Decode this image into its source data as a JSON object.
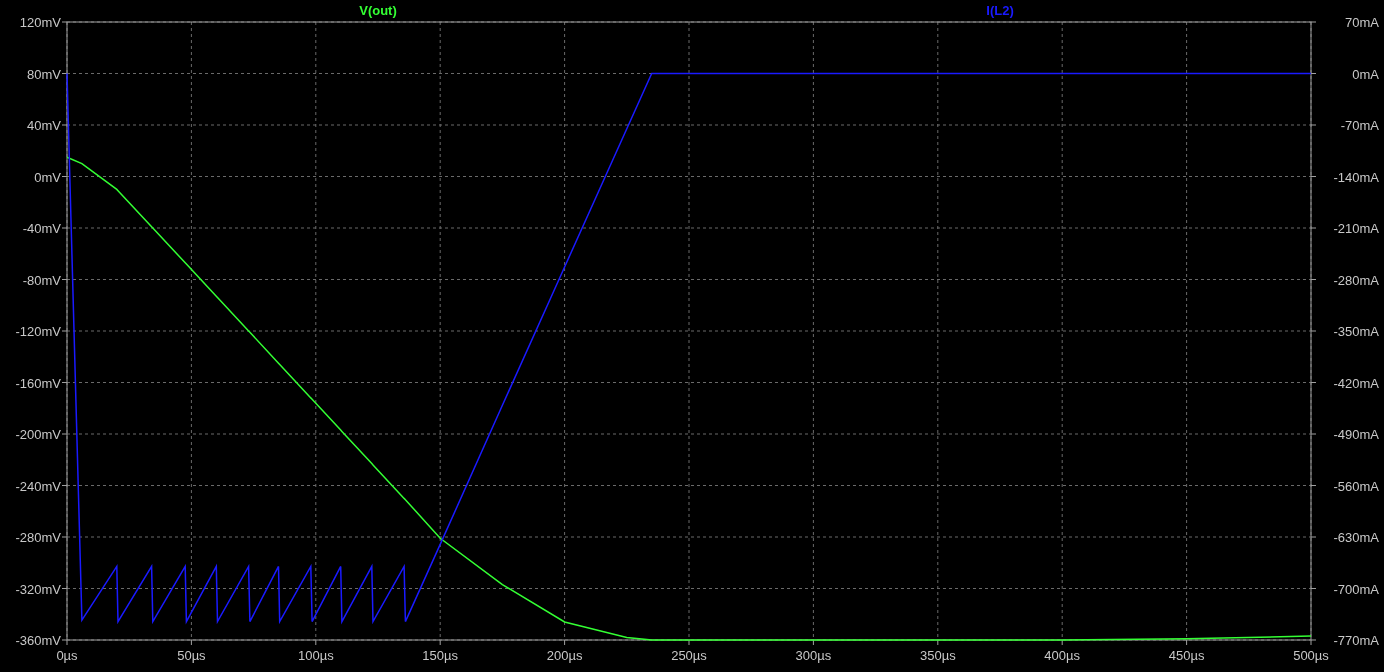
{
  "chart_data": {
    "type": "line",
    "grid": true,
    "xlim": [
      0,
      500
    ],
    "ylim": [
      -360,
      120
    ],
    "y2lim": [
      -770,
      70
    ],
    "xticks": [
      {
        "value": 0,
        "label": "0µs"
      },
      {
        "value": 50,
        "label": "50µs"
      },
      {
        "value": 100,
        "label": "100µs"
      },
      {
        "value": 150,
        "label": "150µs"
      },
      {
        "value": 200,
        "label": "200µs"
      },
      {
        "value": 250,
        "label": "250µs"
      },
      {
        "value": 300,
        "label": "300µs"
      },
      {
        "value": 350,
        "label": "350µs"
      },
      {
        "value": 400,
        "label": "400µs"
      },
      {
        "value": 450,
        "label": "450µs"
      },
      {
        "value": 500,
        "label": "500µs"
      }
    ],
    "yticks": [
      {
        "value": 120,
        "label": "120mV"
      },
      {
        "value": 80,
        "label": "80mV"
      },
      {
        "value": 40,
        "label": "40mV"
      },
      {
        "value": 0,
        "label": "0mV"
      },
      {
        "value": -40,
        "label": "-40mV"
      },
      {
        "value": -80,
        "label": "-80mV"
      },
      {
        "value": -120,
        "label": "-120mV"
      },
      {
        "value": -160,
        "label": "-160mV"
      },
      {
        "value": -200,
        "label": "-200mV"
      },
      {
        "value": -240,
        "label": "-240mV"
      },
      {
        "value": -280,
        "label": "-280mV"
      },
      {
        "value": -320,
        "label": "-320mV"
      },
      {
        "value": -360,
        "label": "-360mV"
      }
    ],
    "y2ticks": [
      {
        "value": 70,
        "label": "70mA"
      },
      {
        "value": 0,
        "label": "0mA"
      },
      {
        "value": -70,
        "label": "-70mA"
      },
      {
        "value": -140,
        "label": "-140mA"
      },
      {
        "value": -210,
        "label": "-210mA"
      },
      {
        "value": -280,
        "label": "-280mA"
      },
      {
        "value": -350,
        "label": "-350mA"
      },
      {
        "value": -420,
        "label": "-420mA"
      },
      {
        "value": -490,
        "label": "-490mA"
      },
      {
        "value": -560,
        "label": "-560mA"
      },
      {
        "value": -630,
        "label": "-630mA"
      },
      {
        "value": -700,
        "label": "-700mA"
      },
      {
        "value": -770,
        "label": "-770mA"
      }
    ],
    "x": [
      0,
      6,
      20,
      20.5,
      34,
      34.5,
      47.5,
      48,
      60,
      60.5,
      73,
      73.5,
      85,
      85.5,
      98,
      98.5,
      110,
      110.5,
      122.5,
      123,
      135.5,
      136,
      150,
      175,
      200,
      225,
      235,
      250,
      300,
      350,
      400,
      450,
      500
    ],
    "series": [
      {
        "name": "V(out)",
        "color": "#33ff33",
        "values": [
          15,
          10,
          -10,
          -11,
          -39,
          -40,
          -67,
          -68,
          -93,
          -94,
          -120,
          -121,
          -145,
          -146,
          -172,
          -173,
          -197,
          -198,
          -223,
          -224,
          -250,
          -251,
          -281,
          -317,
          -346,
          -358,
          -360,
          -360,
          -360,
          -360,
          -360,
          -359,
          -357
        ]
      },
      {
        "name": "I(L2)",
        "color": "#1a1aff",
        "axis": "y2",
        "values": [
          0,
          -743,
          -670,
          -745,
          -670,
          -745,
          -670,
          -745,
          -670,
          -745,
          -670,
          -745,
          -670,
          -745,
          -670,
          -745,
          -670,
          -745,
          -670,
          -745,
          -670,
          -745,
          -640,
          -451,
          -263,
          -75,
          0,
          0,
          0,
          0,
          0,
          0,
          0
        ]
      }
    ]
  }
}
